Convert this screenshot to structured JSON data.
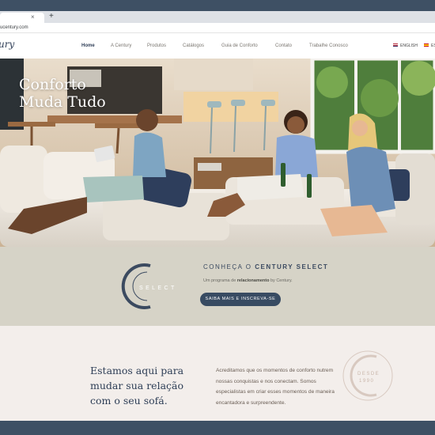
{
  "browser": {
    "tab_close": "×",
    "new_tab": "+",
    "url": "ucentury.com"
  },
  "site": {
    "logo": "ury",
    "nav": [
      "Home",
      "A Century",
      "Produtos",
      "Catálogos",
      "Guia de Conforto",
      "Contato",
      "Trabalhe Conosco"
    ],
    "active_nav": "Home",
    "lang_english": "ENGLISH",
    "lang_es": "ES"
  },
  "hero": {
    "title": "Conforto\nMuda Tudo"
  },
  "select": {
    "logo_text": "SELECT",
    "heading_prefix": "CONHEÇA O ",
    "heading_bold": "CENTURY SELECT",
    "sub_prefix": "Um programa de ",
    "sub_bold": "relacionamento",
    "sub_suffix": " by Century.",
    "button": "SAIBA MAIS E INSCREVA-SE"
  },
  "intro": {
    "title": "Estamos aqui para\nmudar sua relação\ncom o seu sofá.",
    "text": "Acreditamos que os momentos de conforto nutrem nossas conquistas e nos conectam. Somos especialistas em criar esses momentos de maneira encantadora e surpreendente.",
    "seal_top": "DESDE",
    "seal_year": "1990"
  },
  "colors": {
    "navy": "#384b62",
    "band": "#d6d3c7",
    "intro_bg": "#f3eeeb",
    "frame": "#3e5064"
  }
}
